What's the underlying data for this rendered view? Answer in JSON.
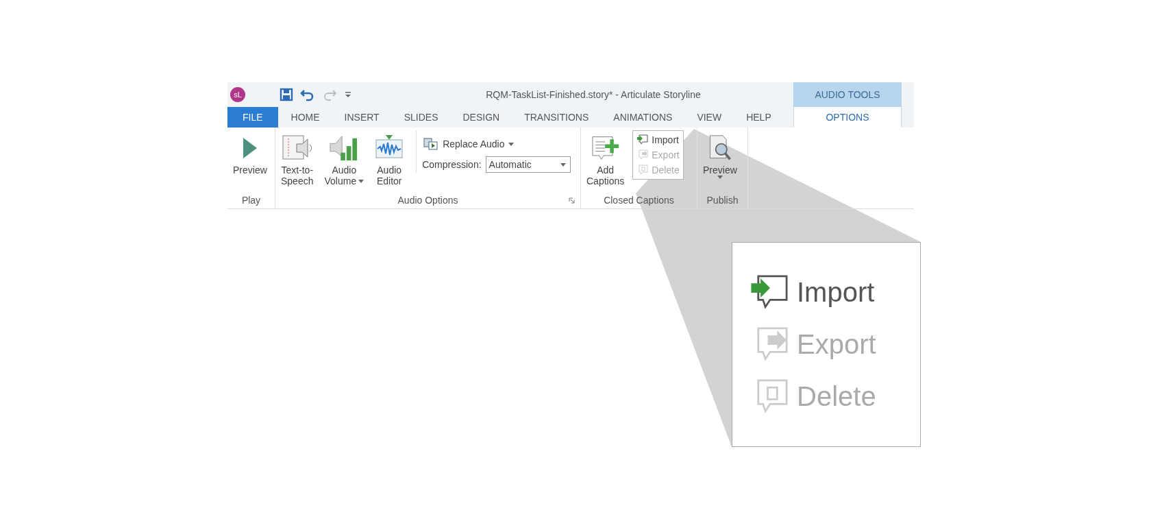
{
  "app_badge": "sL",
  "quick_access": [
    {
      "kind": "save",
      "disabled": false
    },
    {
      "kind": "undo",
      "disabled": false
    },
    {
      "kind": "redo",
      "disabled": true
    },
    {
      "kind": "customize"
    }
  ],
  "window": {
    "title": "RQM-TaskList-Finished.story* -  Articulate Storyline"
  },
  "contextual_group": {
    "label": "AUDIO TOOLS"
  },
  "tabs": [
    {
      "kind": "file",
      "label": "FILE",
      "selected": false
    },
    {
      "kind": "tab",
      "label": "HOME",
      "selected": false
    },
    {
      "kind": "tab",
      "label": "INSERT",
      "selected": false
    },
    {
      "kind": "tab",
      "label": "SLIDES",
      "selected": false
    },
    {
      "kind": "tab",
      "label": "DESIGN",
      "selected": false
    },
    {
      "kind": "tab",
      "label": "TRANSITIONS",
      "selected": false
    },
    {
      "kind": "tab",
      "label": "ANIMATIONS",
      "selected": false
    },
    {
      "kind": "tab",
      "label": "VIEW",
      "selected": false
    },
    {
      "kind": "tab",
      "label": "HELP",
      "selected": false
    },
    {
      "kind": "contextual",
      "label": "OPTIONS",
      "selected": true
    }
  ],
  "groups": [
    {
      "label": "Play",
      "launcher": false,
      "items": [
        {
          "kind": "play",
          "lines": [
            "Preview"
          ],
          "dropdown": false
        }
      ]
    },
    {
      "label": "Audio Options",
      "launcher": true,
      "items": [
        {
          "kind": "tts",
          "lines": [
            "Text-to-",
            "Speech"
          ],
          "dropdown": false
        },
        {
          "kind": "volume",
          "lines": [
            "Audio",
            "Volume"
          ],
          "dropdown": true
        },
        {
          "kind": "editor",
          "lines": [
            "Audio",
            "Editor"
          ],
          "dropdown": false
        },
        {
          "kind": "audio-stack",
          "replace": {
            "label": "Replace Audio"
          },
          "compression": {
            "label": "Compression:",
            "value": "Automatic"
          }
        }
      ]
    },
    {
      "label": "Closed Captions",
      "launcher": false,
      "items": [
        {
          "kind": "add-captions",
          "lines": [
            "Add",
            "Captions"
          ],
          "dropdown": false
        },
        {
          "kind": "caption-list",
          "commands": [
            {
              "kind": "import",
              "label": "Import",
              "disabled": false
            },
            {
              "kind": "export",
              "label": "Export",
              "disabled": true
            },
            {
              "kind": "delete",
              "label": "Delete",
              "disabled": true
            }
          ]
        }
      ]
    },
    {
      "label": "Publish",
      "launcher": false,
      "items": [
        {
          "kind": "preview",
          "lines": [
            "Preview"
          ],
          "dropdown": true
        }
      ]
    }
  ],
  "callout": {
    "commands": [
      {
        "kind": "import",
        "label": "Import",
        "disabled": false
      },
      {
        "kind": "export",
        "label": "Export",
        "disabled": true
      },
      {
        "kind": "delete",
        "label": "Delete",
        "disabled": true
      }
    ]
  }
}
